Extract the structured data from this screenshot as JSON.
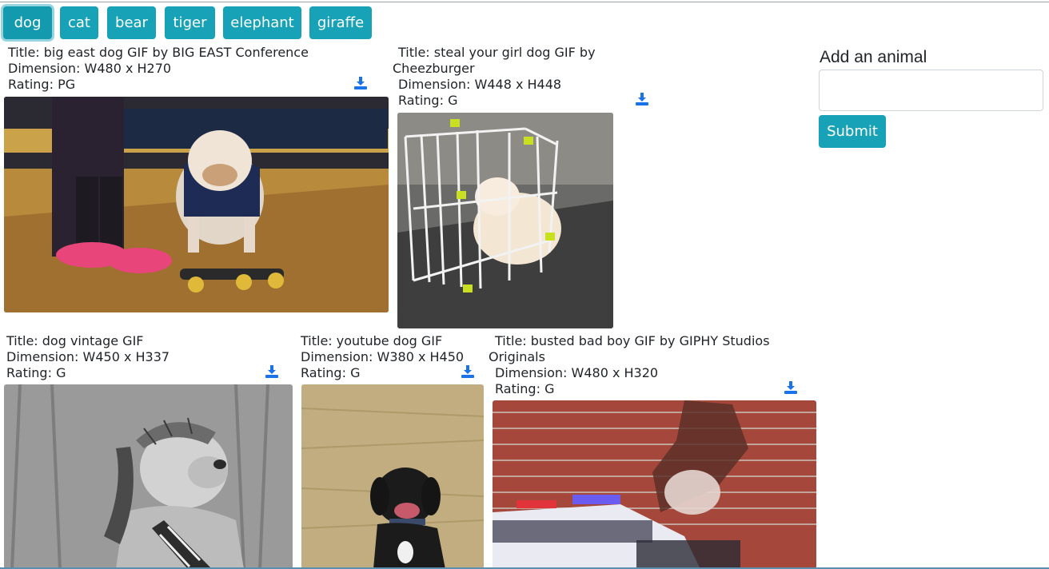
{
  "animal_buttons": [
    "dog",
    "cat",
    "bear",
    "tiger",
    "elephant",
    "giraffe"
  ],
  "active_animal": "dog",
  "gifs": [
    {
      "title": "Title: big east dog GIF by BIG EAST Conference",
      "dimension": "Dimension: W480 x H270",
      "rating": "Rating: PG",
      "image": "bulldog-on-skateboard"
    },
    {
      "title": "Title: steal your girl dog GIF by",
      "title_line2": "Cheezburger",
      "dimension": "Dimension: W448 x H448",
      "rating": "Rating: G",
      "image": "puppy-in-playpen"
    },
    {
      "title": "Title: dog vintage GIF",
      "dimension": "Dimension: W450 x H337",
      "rating": "Rating: G",
      "image": "vintage-dog-saxophone"
    },
    {
      "title": "Title: youtube dog GIF",
      "dimension": "Dimension: W380 x H450",
      "rating": "Rating: G",
      "image": "black-dog-in-field"
    },
    {
      "title": "Title: busted bad boy GIF by GIPHY Studios",
      "title_line2": "Originals",
      "dimension": "Dimension: W480 x H320",
      "rating": "Rating: G",
      "image": "dog-mural-police-car"
    }
  ],
  "form": {
    "label": "Add an animal",
    "input_value": "",
    "submit_label": "Submit"
  },
  "icons": {
    "download": "download-icon"
  },
  "colors": {
    "button": "#17a2b8",
    "download_icon": "#1a73e8"
  }
}
